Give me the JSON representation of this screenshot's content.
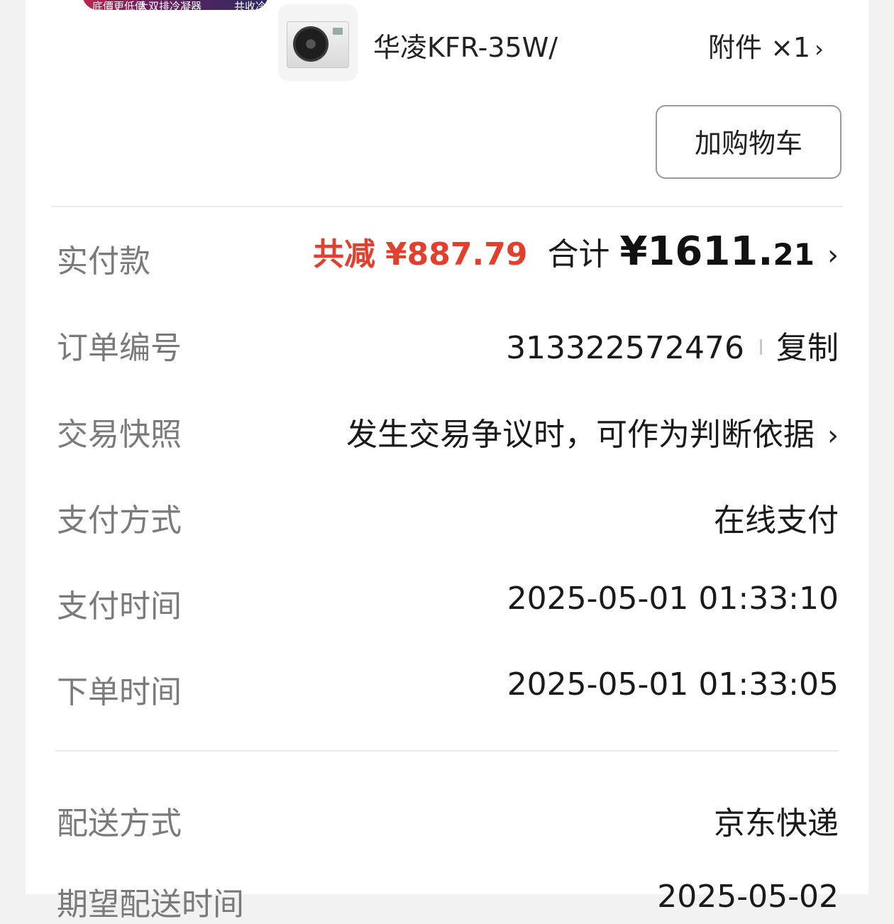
{
  "banner": {
    "text1": "底價更低價",
    "text2": "大双排冷凝器",
    "text3": "共收冷"
  },
  "product": {
    "title": "华凌KFR-35W/",
    "attachment": "附件 ×1",
    "add_to_cart": "加购物车"
  },
  "payment_summary": {
    "label": "实付款",
    "reduce_label": "共减",
    "reduce_amount": "¥887.79",
    "total_label": "合计",
    "currency": "¥",
    "total_int": "1611.",
    "total_dec": "21"
  },
  "order_number": {
    "label": "订单编号",
    "value": "313322572476",
    "copy": "复制"
  },
  "snapshot": {
    "label": "交易快照",
    "value": "发生交易争议时，可作为判断依据"
  },
  "pay_method": {
    "label": "支付方式",
    "value": "在线支付"
  },
  "pay_time": {
    "label": "支付时间",
    "value": "2025-05-01 01:33:10"
  },
  "order_time": {
    "label": "下单时间",
    "value": "2025-05-01 01:33:05"
  },
  "delivery": {
    "label": "配送方式",
    "value": "京东快递"
  },
  "expected_delivery": {
    "label": "期望配送时间",
    "value": "2025-05-02"
  }
}
